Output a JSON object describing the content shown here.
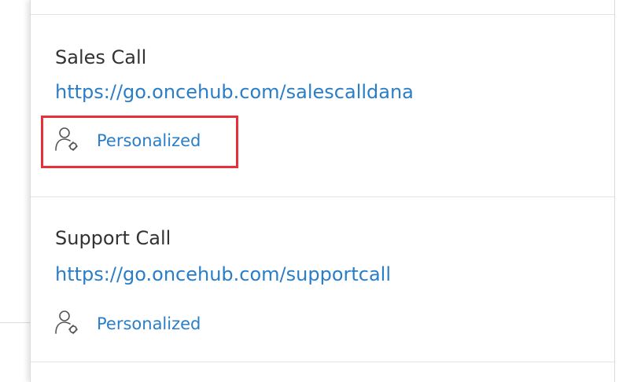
{
  "cards": [
    {
      "title": "Sales Call",
      "link": "https://go.oncehub.com/salescalldana",
      "badge_label": "Personalized",
      "badge_icon": "user-link-icon"
    },
    {
      "title": "Support Call",
      "link": "https://go.oncehub.com/supportcall",
      "badge_label": "Personalized",
      "badge_icon": "user-link-icon"
    }
  ],
  "colors": {
    "link": "#2a7ec8",
    "title": "#333333",
    "highlight": "#e8303a",
    "divider": "#e3e3e3"
  }
}
